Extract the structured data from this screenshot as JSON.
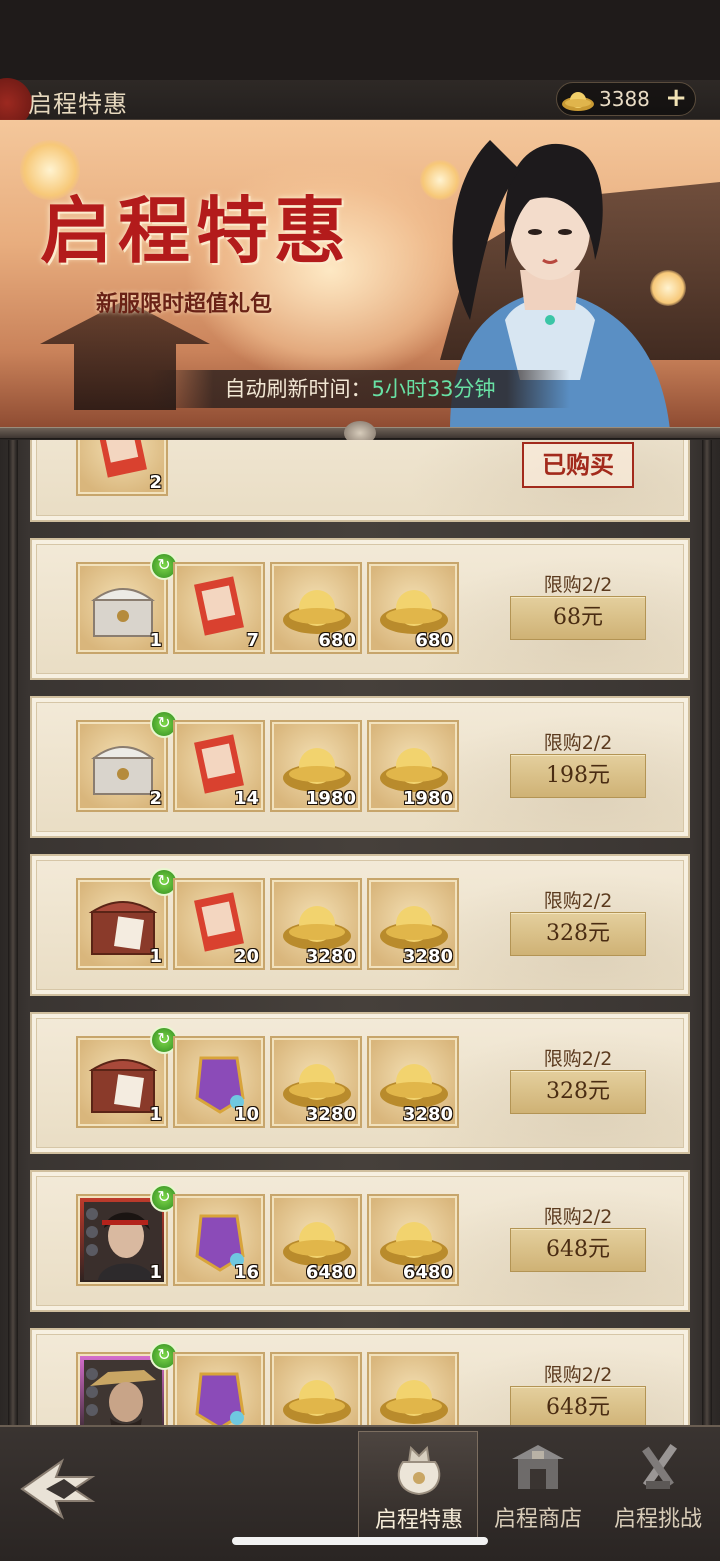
{
  "header": {
    "title": "启程特惠",
    "currency": {
      "icon": "gold-ingot-icon",
      "amount": "3388",
      "add_label": "+"
    }
  },
  "banner": {
    "title": "启程特惠",
    "subtitle": "新服限时超值礼包",
    "refresh_label": "自动刷新时间：",
    "refresh_time": "5小时33分钟"
  },
  "packages": [
    {
      "status": "已购买",
      "items": [
        {
          "icon": "recruit-scroll-icon",
          "qty": "2"
        }
      ]
    },
    {
      "limit": "限购2/2",
      "price": "68元",
      "items": [
        {
          "icon": "silver-chest-icon",
          "qty": "1",
          "badge": true
        },
        {
          "icon": "recruit-scroll-icon",
          "qty": "7"
        },
        {
          "icon": "gold-ingot-icon",
          "qty": "680"
        },
        {
          "icon": "gold-ingot-icon",
          "qty": "680"
        }
      ]
    },
    {
      "limit": "限购2/2",
      "price": "198元",
      "items": [
        {
          "icon": "silver-chest-icon",
          "qty": "2",
          "badge": true
        },
        {
          "icon": "recruit-scroll-icon",
          "qty": "14"
        },
        {
          "icon": "gold-ingot-icon",
          "qty": "1980"
        },
        {
          "icon": "gold-ingot-icon",
          "qty": "1980"
        }
      ]
    },
    {
      "limit": "限购2/2",
      "price": "328元",
      "items": [
        {
          "icon": "limited-chest-icon",
          "qty": "1",
          "badge": true
        },
        {
          "icon": "recruit-scroll-icon",
          "qty": "20"
        },
        {
          "icon": "gold-ingot-icon",
          "qty": "3280"
        },
        {
          "icon": "gold-ingot-icon",
          "qty": "3280"
        }
      ]
    },
    {
      "limit": "限购2/2",
      "price": "328元",
      "items": [
        {
          "icon": "limited-chest-icon",
          "qty": "1",
          "badge": true
        },
        {
          "icon": "purple-token-icon",
          "qty": "10"
        },
        {
          "icon": "gold-ingot-icon",
          "qty": "3280"
        },
        {
          "icon": "gold-ingot-icon",
          "qty": "3280"
        }
      ]
    },
    {
      "limit": "限购2/2",
      "price": "648元",
      "items": [
        {
          "icon": "hero-portrait-icon",
          "qty": "1",
          "badge": true
        },
        {
          "icon": "purple-token-icon",
          "qty": "16"
        },
        {
          "icon": "gold-ingot-icon",
          "qty": "6480"
        },
        {
          "icon": "gold-ingot-icon",
          "qty": "6480"
        }
      ]
    },
    {
      "limit": "限购2/2",
      "price": "648元",
      "items": [
        {
          "icon": "hero-portrait-icon",
          "qty": "",
          "badge": true
        },
        {
          "icon": "purple-token-icon",
          "qty": ""
        },
        {
          "icon": "gold-ingot-icon",
          "qty": ""
        },
        {
          "icon": "gold-ingot-icon",
          "qty": ""
        }
      ]
    }
  ],
  "nav": {
    "back_icon": "back-arrow-icon",
    "tabs": [
      {
        "label": "启程特惠",
        "icon": "gift-bag-icon",
        "active": true
      },
      {
        "label": "启程商店",
        "icon": "shop-pavilion-icon",
        "active": false
      },
      {
        "label": "启程挑战",
        "icon": "crossed-swords-icon",
        "active": false
      }
    ]
  },
  "colors": {
    "accent_gold": "#cfb275",
    "refresh_green": "#68e0a4",
    "stamp_red": "#a22a1c"
  }
}
